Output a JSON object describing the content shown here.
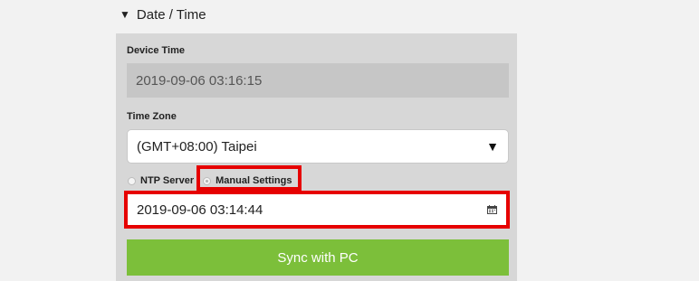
{
  "section": {
    "title": "Date / Time",
    "collapse_icon": "triangle-down-icon"
  },
  "device_time": {
    "label": "Device Time",
    "value": "2019-09-06 03:16:15"
  },
  "time_zone": {
    "label": "Time Zone",
    "selected": "(GMT+08:00) Taipei",
    "caret_icon": "caret-down-icon"
  },
  "sync_mode": {
    "options": [
      {
        "label": "NTP Server",
        "checked": false
      },
      {
        "label": "Manual Settings",
        "checked": true
      }
    ]
  },
  "manual_time": {
    "value": "2019-09-06 03:14:44",
    "icon": "calendar-icon"
  },
  "sync_button": {
    "label": "Sync with PC",
    "color": "#7cbf3a"
  },
  "colors": {
    "highlight": "#e60000",
    "panel": "#d7d7d7"
  }
}
